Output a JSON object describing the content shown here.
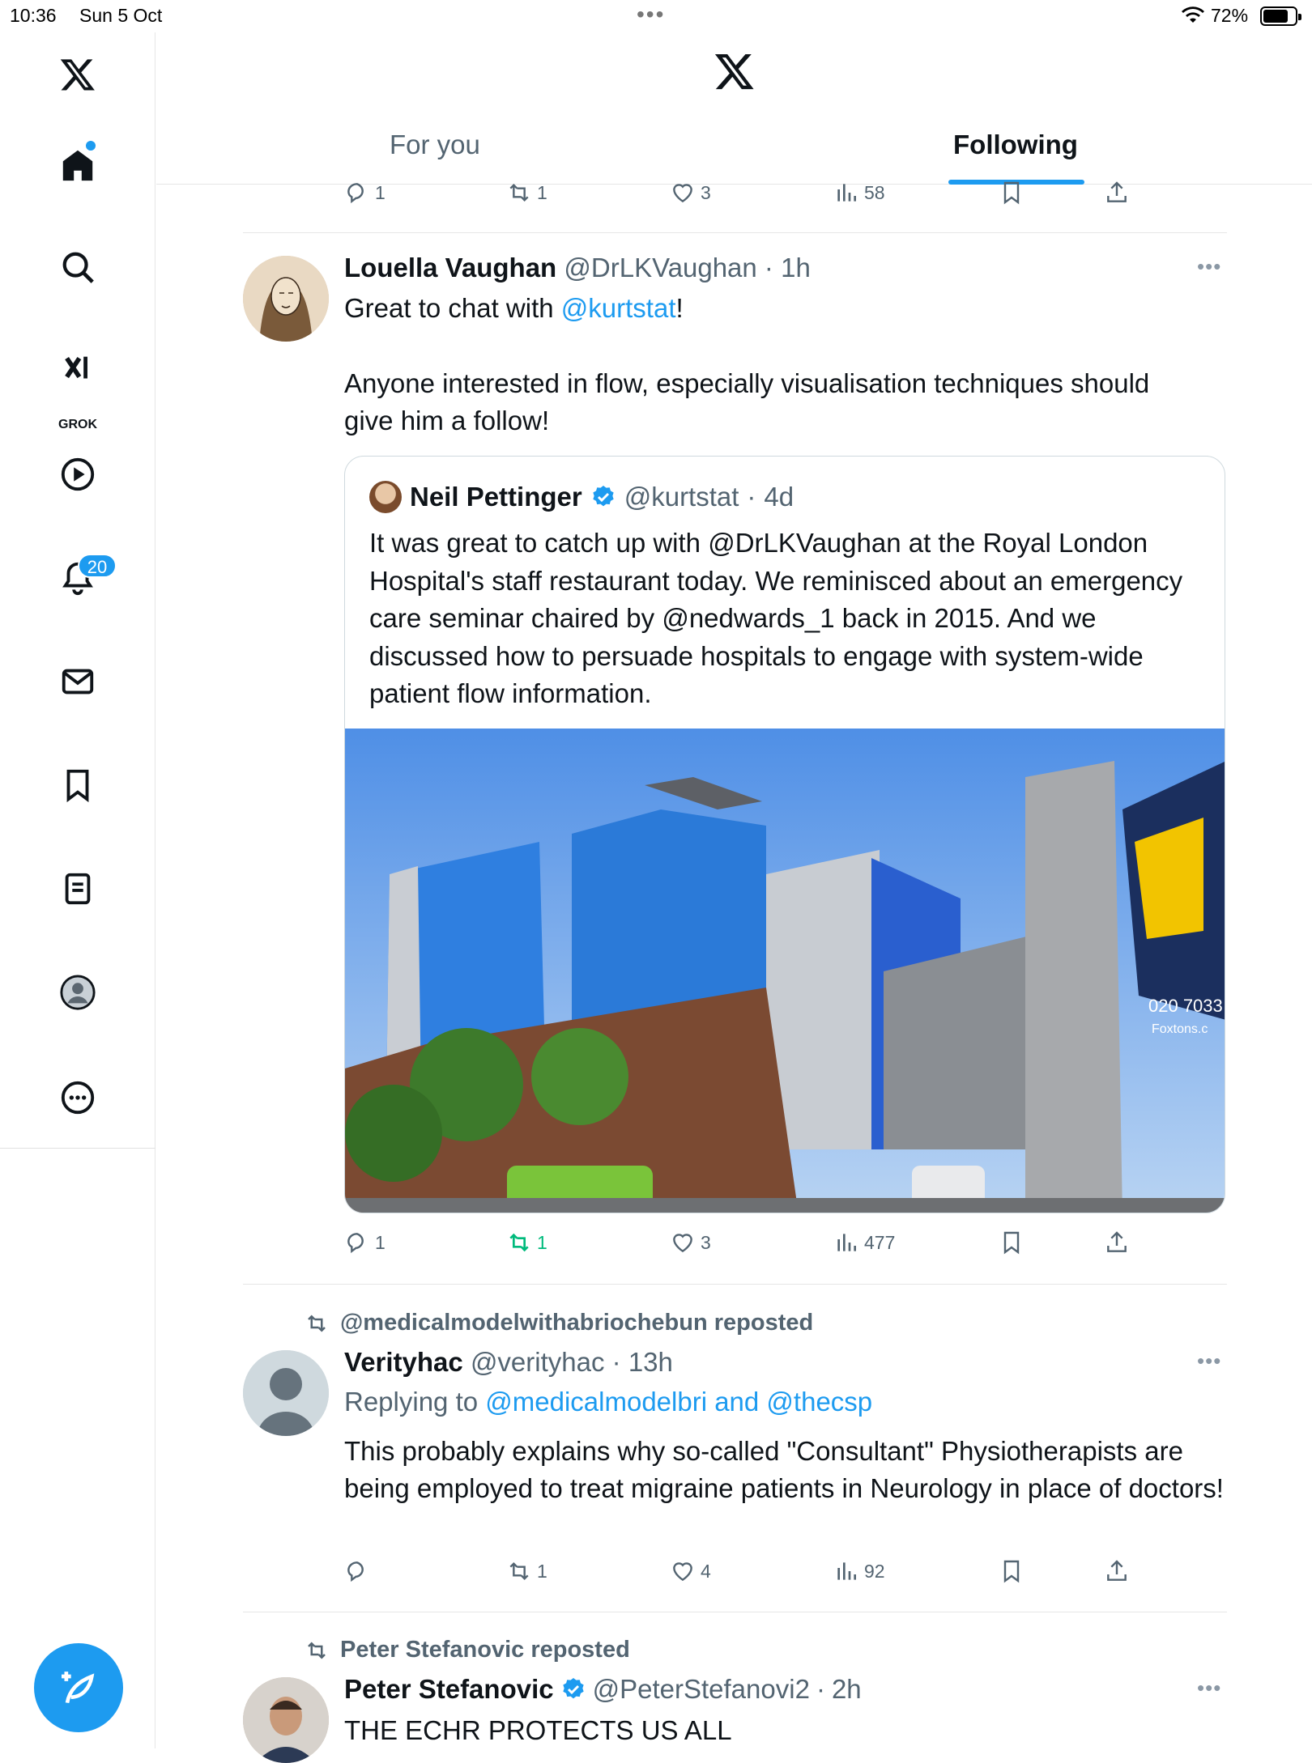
{
  "status_bar": {
    "time": "10:36",
    "date": "Sun 5 Oct",
    "battery": "72%"
  },
  "sidebar": {
    "items": [
      {
        "name": "x-logo"
      },
      {
        "name": "home"
      },
      {
        "name": "search"
      },
      {
        "name": "grok",
        "label": "GROK"
      },
      {
        "name": "videos"
      },
      {
        "name": "notifications",
        "badge": "20"
      },
      {
        "name": "messages"
      },
      {
        "name": "bookmarks"
      },
      {
        "name": "lists"
      },
      {
        "name": "profile"
      },
      {
        "name": "more"
      }
    ]
  },
  "header": {
    "tabs": [
      {
        "label": "For you"
      },
      {
        "label": "Following",
        "active": true
      }
    ]
  },
  "prev_actions": {
    "reply": "1",
    "repost": "1",
    "like": "3",
    "views": "58"
  },
  "tweet1": {
    "name": "Louella Vaughan",
    "handle": "@DrLKVaughan",
    "time": "1h",
    "text_pre": "Great to chat with ",
    "mention": "@kurtstat",
    "text_post": "!",
    "text2": "Anyone interested in flow, especially visualisation techniques should give him a follow!",
    "quote": {
      "name": "Neil Pettinger",
      "handle": "@kurtstat",
      "time": "4d",
      "text": "It was great to catch up with @DrLKVaughan at the Royal London Hospital's staff restaurant today. We reminisced about an emergency care seminar chaired by @nedwards_1 back in 2015. And we discussed how to persuade hospitals to engage with system-wide patient flow information.",
      "sign_text": "020 7033",
      "sign_sub": "Foxtons.c"
    },
    "actions": {
      "reply": "1",
      "repost": "1",
      "like": "3",
      "views": "477"
    }
  },
  "tweet2": {
    "reposted_by": "@medicalmodelwithabriochebun reposted",
    "name": "Verityhac",
    "handle": "@verityhac",
    "time": "13h",
    "replying_prefix": "Replying to ",
    "replying_to": "@medicalmodelbri and @thecsp",
    "text": "This probably explains why so-called \"Consultant\" Physiotherapists are being employed to treat migraine patients in Neurology in place of doctors!",
    "actions": {
      "reply": "",
      "repost": "1",
      "like": "4",
      "views": "92"
    }
  },
  "tweet3": {
    "reposted_by": "Peter Stefanovic reposted",
    "name": "Peter Stefanovic",
    "handle": "@PeterStefanovi2",
    "time": "2h",
    "text": "THE ECHR PROTECTS US ALL"
  },
  "colors": {
    "accent": "#1d9bf0",
    "repost_green": "#00ba7c",
    "secondary_text": "#536471"
  }
}
